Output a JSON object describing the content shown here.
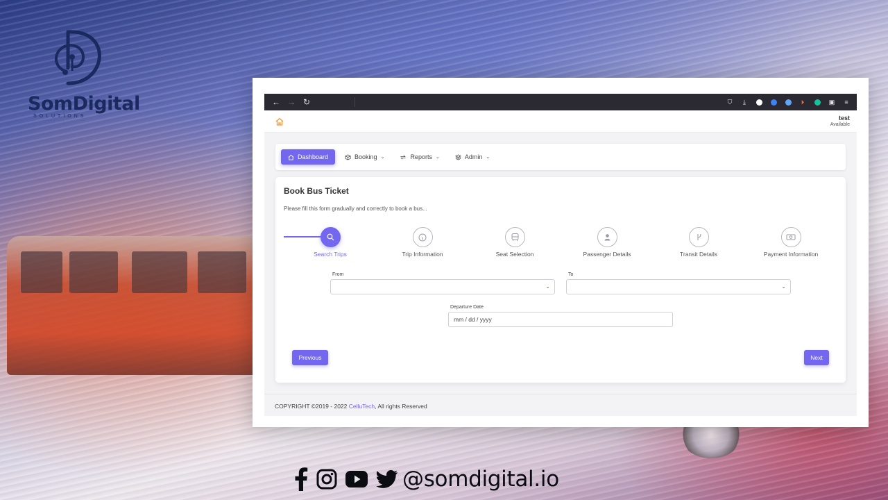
{
  "brand": {
    "name": "SomDigital",
    "tagline": "SOLUTIONS"
  },
  "browser": {
    "nav_icons": [
      "back-arrow-icon",
      "forward-arrow-icon",
      "reload-icon"
    ],
    "extension_icons": [
      "pocket-icon",
      "download-icon",
      "info-icon",
      "extension-icon",
      "notification-icon",
      "extension-icon",
      "grammarly-icon",
      "reader-icon",
      "menu-icon"
    ]
  },
  "app": {
    "user": {
      "name": "test",
      "status": "Available"
    },
    "menu": [
      {
        "label": "Dashboard",
        "icon": "home-icon",
        "active": true,
        "dropdown": false
      },
      {
        "label": "Booking",
        "icon": "box-icon",
        "active": false,
        "dropdown": true
      },
      {
        "label": "Reports",
        "icon": "repeat-icon",
        "active": false,
        "dropdown": true
      },
      {
        "label": "Admin",
        "icon": "layers-icon",
        "active": false,
        "dropdown": true
      }
    ],
    "form": {
      "title": "Book Bus Ticket",
      "description": "Please fill this form gradually and correctly to book a bus...",
      "steps": [
        {
          "label": "Search Trips",
          "icon": "search-icon",
          "active": true
        },
        {
          "label": "Trip Information",
          "icon": "info-icon",
          "active": false
        },
        {
          "label": "Seat Selection",
          "icon": "bus-icon",
          "active": false
        },
        {
          "label": "Passenger Details",
          "icon": "user-icon",
          "active": false
        },
        {
          "label": "Transit Details",
          "icon": "transit-icon",
          "active": false
        },
        {
          "label": "Payment Information",
          "icon": "money-icon",
          "active": false
        }
      ],
      "from_label": "From",
      "to_label": "To",
      "from_value": "",
      "to_value": "",
      "departure_label": "Departure Date",
      "departure_placeholder": "mm / dd / yyyy",
      "previous_label": "Previous",
      "next_label": "Next"
    },
    "footer": {
      "prefix": "COPYRIGHT ©2019 - 2022 ",
      "link": "CelluTech",
      "suffix": ", All rights Reserved"
    }
  },
  "social": {
    "icons": [
      "facebook-icon",
      "instagram-icon",
      "youtube-icon",
      "twitter-icon"
    ],
    "handle": "@somdigital.io"
  },
  "colors": {
    "accent": "#7367f0",
    "brand": "#1b2a5e",
    "toolbar": "#2b2a33",
    "home_icon": "#f29b38"
  }
}
